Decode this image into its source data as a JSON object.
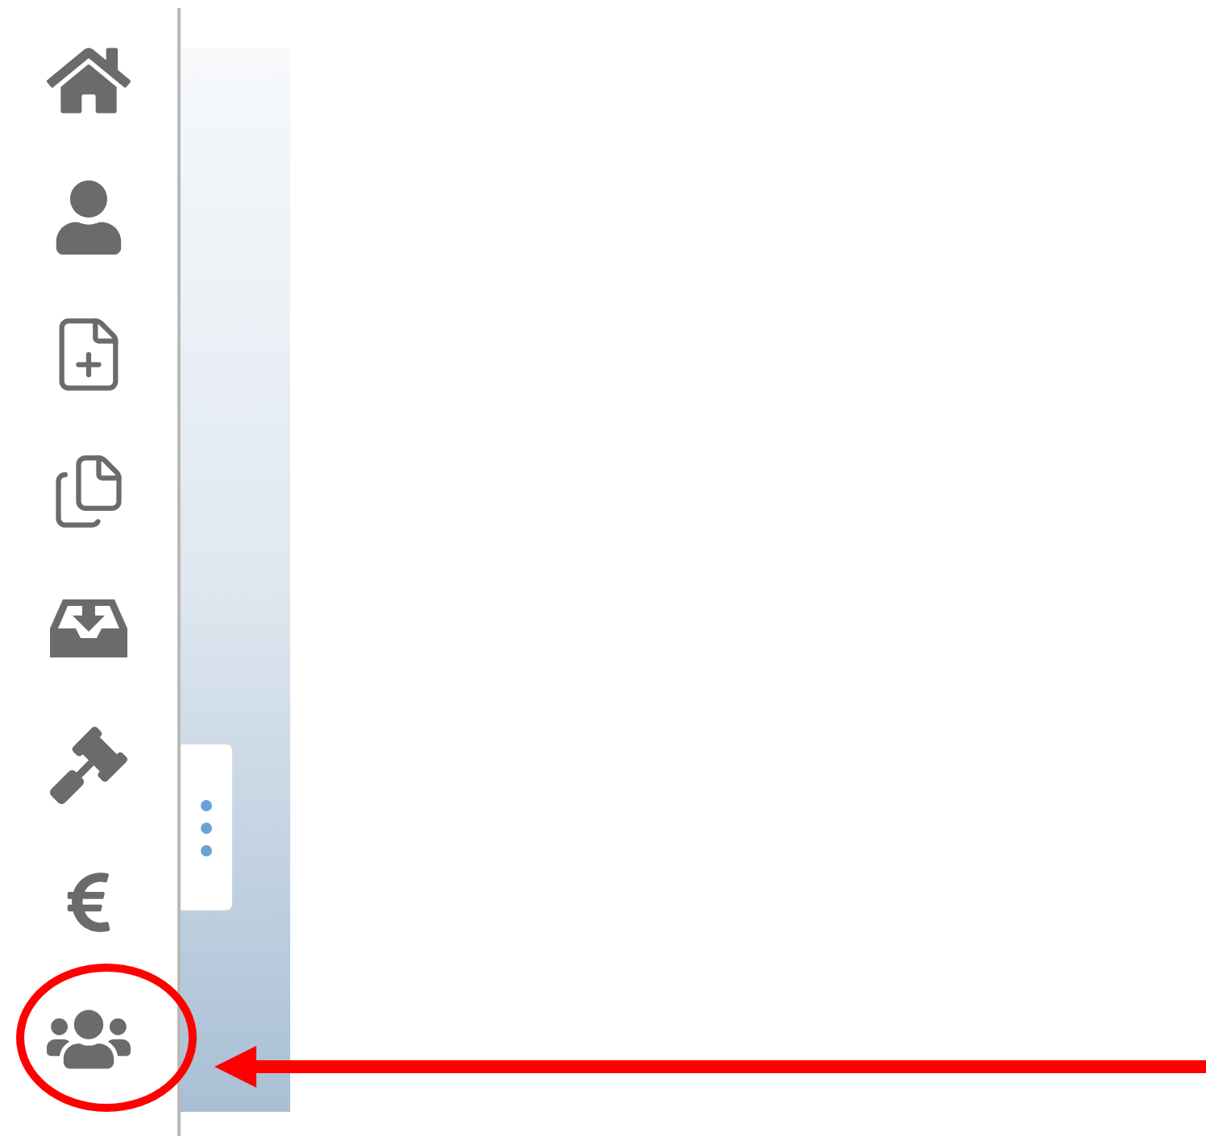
{
  "sidebar": {
    "items": [
      {
        "kind": "home",
        "annotated": false
      },
      {
        "kind": "user",
        "annotated": false
      },
      {
        "kind": "new-document",
        "annotated": false
      },
      {
        "kind": "documents",
        "annotated": false
      },
      {
        "kind": "inbox",
        "annotated": false
      },
      {
        "kind": "gavel",
        "annotated": false
      },
      {
        "kind": "euro",
        "annotated": false
      },
      {
        "kind": "group",
        "annotated": true
      }
    ]
  }
}
